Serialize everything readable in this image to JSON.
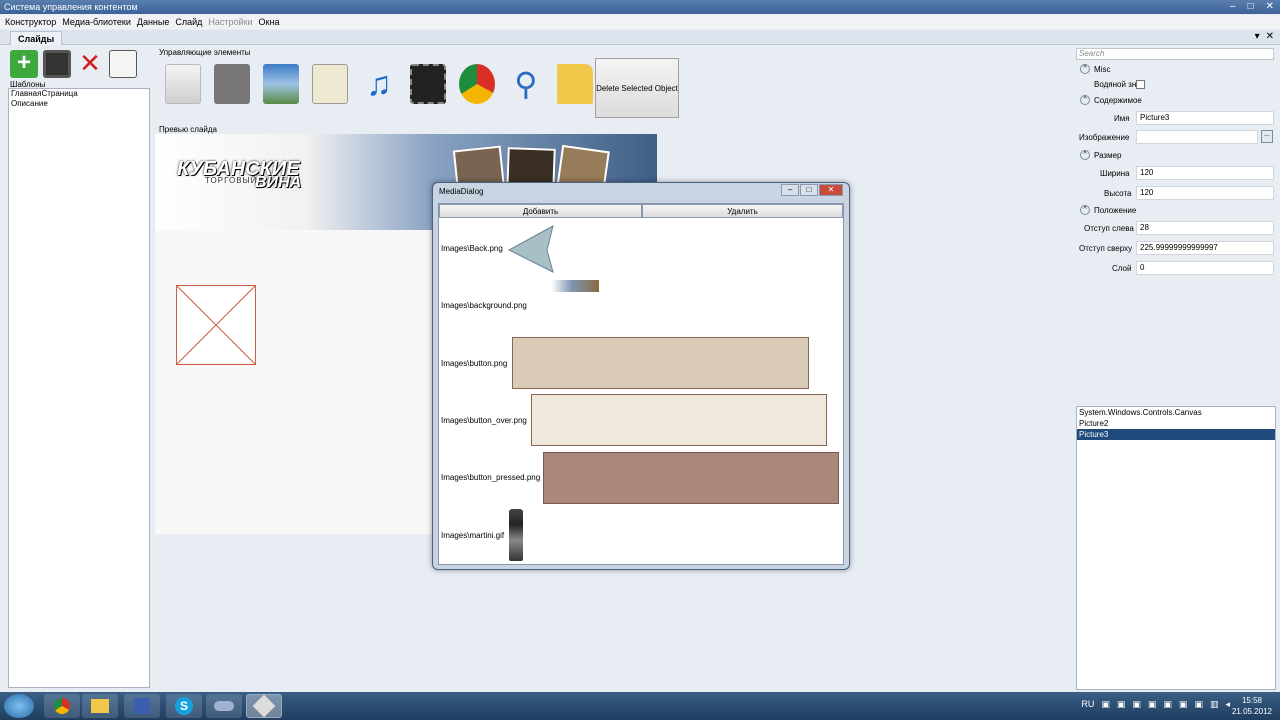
{
  "window": {
    "title": "Система управления контентом"
  },
  "menu": [
    "Конструктор",
    "Медиа-блиотеки",
    "Данные",
    "Слайд",
    "Настройки",
    "Окна"
  ],
  "tab": {
    "label": "Слайды"
  },
  "left": {
    "templates_label": "Шаблоны",
    "templates": [
      "ГлавнаяСтраница",
      "Описание"
    ]
  },
  "controls": {
    "label": "Управляющие элементы",
    "delete_button": "Delete Selected Object"
  },
  "preview": {
    "label": "Превью слайда",
    "logo_line1": "КУБАНСКИЕ",
    "logo_line2": "ТОРГОВЫЙ ЦЕНТР",
    "logo_line3": "ВИНА"
  },
  "props": {
    "search_placeholder": "Search",
    "misc_group": "Misc",
    "watermark_label": "Водяной знак",
    "content_group": "Содержимое",
    "name_label": "Имя",
    "name_value": "Picture3",
    "image_label": "Изображение",
    "size_group": "Размер",
    "width_label": "Ширина",
    "width_value": "120",
    "height_label": "Высота",
    "height_value": "120",
    "position_group": "Положение",
    "left_label": "Отступ слева",
    "left_value": "28",
    "top_label": "Отступ сверху",
    "top_value": "225.99999999999997",
    "layer_label": "Слой",
    "layer_value": "0"
  },
  "objects": [
    "System.Windows.Controls.Canvas",
    "Picture2",
    "Picture3"
  ],
  "dialog": {
    "title": "MediaDialog",
    "add_button": "Добавить",
    "remove_button": "Удалить",
    "items": [
      "Images\\Back.png",
      "Images\\background.png",
      "Images\\button.png",
      "Images\\button_over.png",
      "Images\\button_pressed.png",
      "Images\\martini.gif"
    ]
  },
  "taskbar": {
    "lang": "RU",
    "time": "15:58",
    "date": "21.05.2012"
  },
  "colors": {
    "button": "#d9cbb8",
    "button_over": "#f0e8dc",
    "button_pressed": "#a9877a",
    "selection": "#1e4a7c"
  }
}
